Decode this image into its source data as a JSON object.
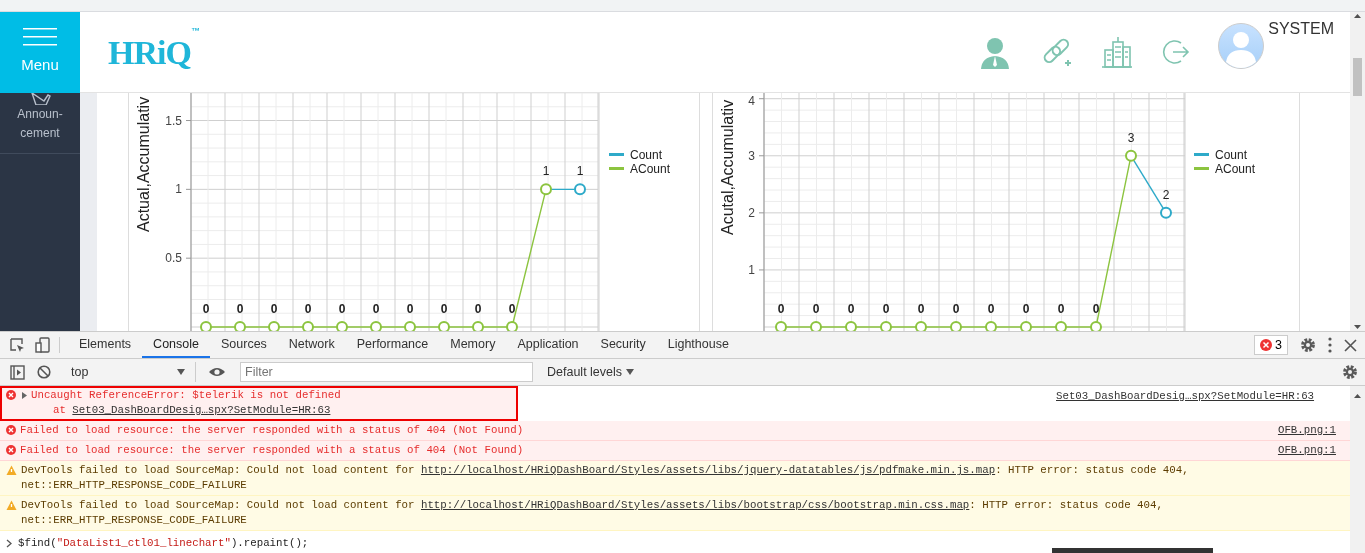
{
  "header": {
    "menu_label": "Menu",
    "logo": "HRiQ",
    "logo_mark": "™",
    "user_name": "SYSTEM"
  },
  "sidebar": {
    "items": [
      {
        "label": "Announ-cement"
      }
    ]
  },
  "charts": [
    {
      "chart_data": {
        "type": "line",
        "ylabel": "Actual,Accumulativ",
        "ylim": [
          0,
          1.7
        ],
        "yticks": [
          0.5,
          1,
          1.5
        ],
        "grid": true,
        "legend": "right",
        "series": [
          {
            "name": "Count",
            "color": "#2eaac9",
            "marker": true,
            "values": [
              null,
              null,
              null,
              null,
              null,
              null,
              null,
              null,
              null,
              null,
              1,
              1
            ],
            "value_labels": [
              null,
              null,
              null,
              null,
              null,
              null,
              null,
              null,
              null,
              null,
              null,
              "1"
            ]
          },
          {
            "name": "ACount",
            "color": "#8cc43f",
            "marker": true,
            "values": [
              0,
              0,
              0,
              0,
              0,
              0,
              0,
              0,
              0,
              0,
              1,
              null
            ],
            "value_labels": [
              "0",
              "0",
              "0",
              "0",
              "0",
              "0",
              "0",
              "0",
              "0",
              "0",
              "1",
              null
            ]
          }
        ]
      }
    },
    {
      "chart_data": {
        "type": "line",
        "ylabel": "Acutal,Accumulativ",
        "ylim": [
          0,
          4.1
        ],
        "yticks": [
          1,
          2,
          3,
          4
        ],
        "grid": true,
        "legend": "right",
        "series": [
          {
            "name": "Count",
            "color": "#2eaac9",
            "marker": true,
            "values": [
              null,
              null,
              null,
              null,
              null,
              null,
              null,
              null,
              null,
              null,
              3,
              2
            ],
            "value_labels": [
              null,
              null,
              null,
              null,
              null,
              null,
              null,
              null,
              null,
              null,
              null,
              "2"
            ]
          },
          {
            "name": "ACount",
            "color": "#8cc43f",
            "marker": true,
            "values": [
              0,
              0,
              0,
              0,
              0,
              0,
              0,
              0,
              0,
              0,
              3,
              null
            ],
            "value_labels": [
              "0",
              "0",
              "0",
              "0",
              "0",
              "0",
              "0",
              "0",
              "0",
              "0",
              "3",
              null
            ]
          }
        ]
      }
    }
  ],
  "devtools": {
    "tabs": [
      {
        "label": "Elements",
        "selected": false
      },
      {
        "label": "Console",
        "selected": true
      },
      {
        "label": "Sources",
        "selected": false
      },
      {
        "label": "Network",
        "selected": false
      },
      {
        "label": "Performance",
        "selected": false
      },
      {
        "label": "Memory",
        "selected": false
      },
      {
        "label": "Application",
        "selected": false
      },
      {
        "label": "Security",
        "selected": false
      },
      {
        "label": "Lighthouse",
        "selected": false
      }
    ],
    "error_count": "3",
    "context": "top",
    "filter_placeholder": "Filter",
    "levels": "Default levels",
    "messages": [
      {
        "kind": "error",
        "highlighted": true,
        "expandable": true,
        "text": "Uncaught ReferenceError: $telerik is not defined",
        "trace_prefix": "at ",
        "trace_link": "Set03_DashBoardDesig…spx?SetModule=HR:63",
        "source": "Set03_DashBoardDesig…spx?SetModule=HR:63"
      },
      {
        "kind": "error",
        "highlighted": false,
        "expandable": false,
        "text": "Failed to load resource: the server responded with a status of 404 (Not Found)",
        "source": "OFB.png:1"
      },
      {
        "kind": "error",
        "highlighted": false,
        "expandable": false,
        "text": "Failed to load resource: the server responded with a status of 404 (Not Found)",
        "source": "OFB.png:1"
      },
      {
        "kind": "warning",
        "highlighted": false,
        "expandable": false,
        "text": "DevTools failed to load SourceMap: Could not load content for ",
        "link": "http://localhost/HRiQDashBoard/Styles/assets/libs/jquery-datatables/js/pdfmake.min.js.map",
        "text_after": ": HTTP error: status code 404, net::ERR_HTTP_RESPONSE_CODE_FAILURE"
      },
      {
        "kind": "warning",
        "highlighted": false,
        "expandable": false,
        "text": "DevTools failed to load SourceMap: Could not load content for ",
        "link": "http://localhost/HRiQDashBoard/Styles/assets/libs/bootstrap/css/bootstrap.min.css.map",
        "text_after": ": HTTP error: status code 404, net::ERR_HTTP_RESPONSE_CODE_FAILURE"
      }
    ],
    "prompt": {
      "before": "$find(",
      "string": "\"DataList1_ctl01_linechart\"",
      "after": ").repaint();"
    }
  }
}
